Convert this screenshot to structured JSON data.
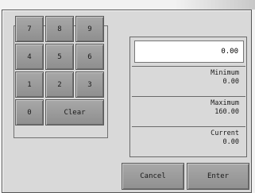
{
  "keypad": {
    "k7": "7",
    "k8": "8",
    "k9": "9",
    "k4": "4",
    "k5": "5",
    "k6": "6",
    "k1": "1",
    "k2": "2",
    "k3": "3",
    "k0": "0",
    "clear": "Clear"
  },
  "entry": {
    "value": "0.00"
  },
  "minimum": {
    "label": "Minimum",
    "value": "0.00"
  },
  "maximum": {
    "label": "Maximum",
    "value": "160.00"
  },
  "current": {
    "label": "Current",
    "value": "0.00"
  },
  "actions": {
    "cancel": "Cancel",
    "enter": "Enter"
  },
  "colors": {
    "panel": "#d9d9d9",
    "key": "#9c9c9c",
    "entry_bg": "#ffffff"
  }
}
